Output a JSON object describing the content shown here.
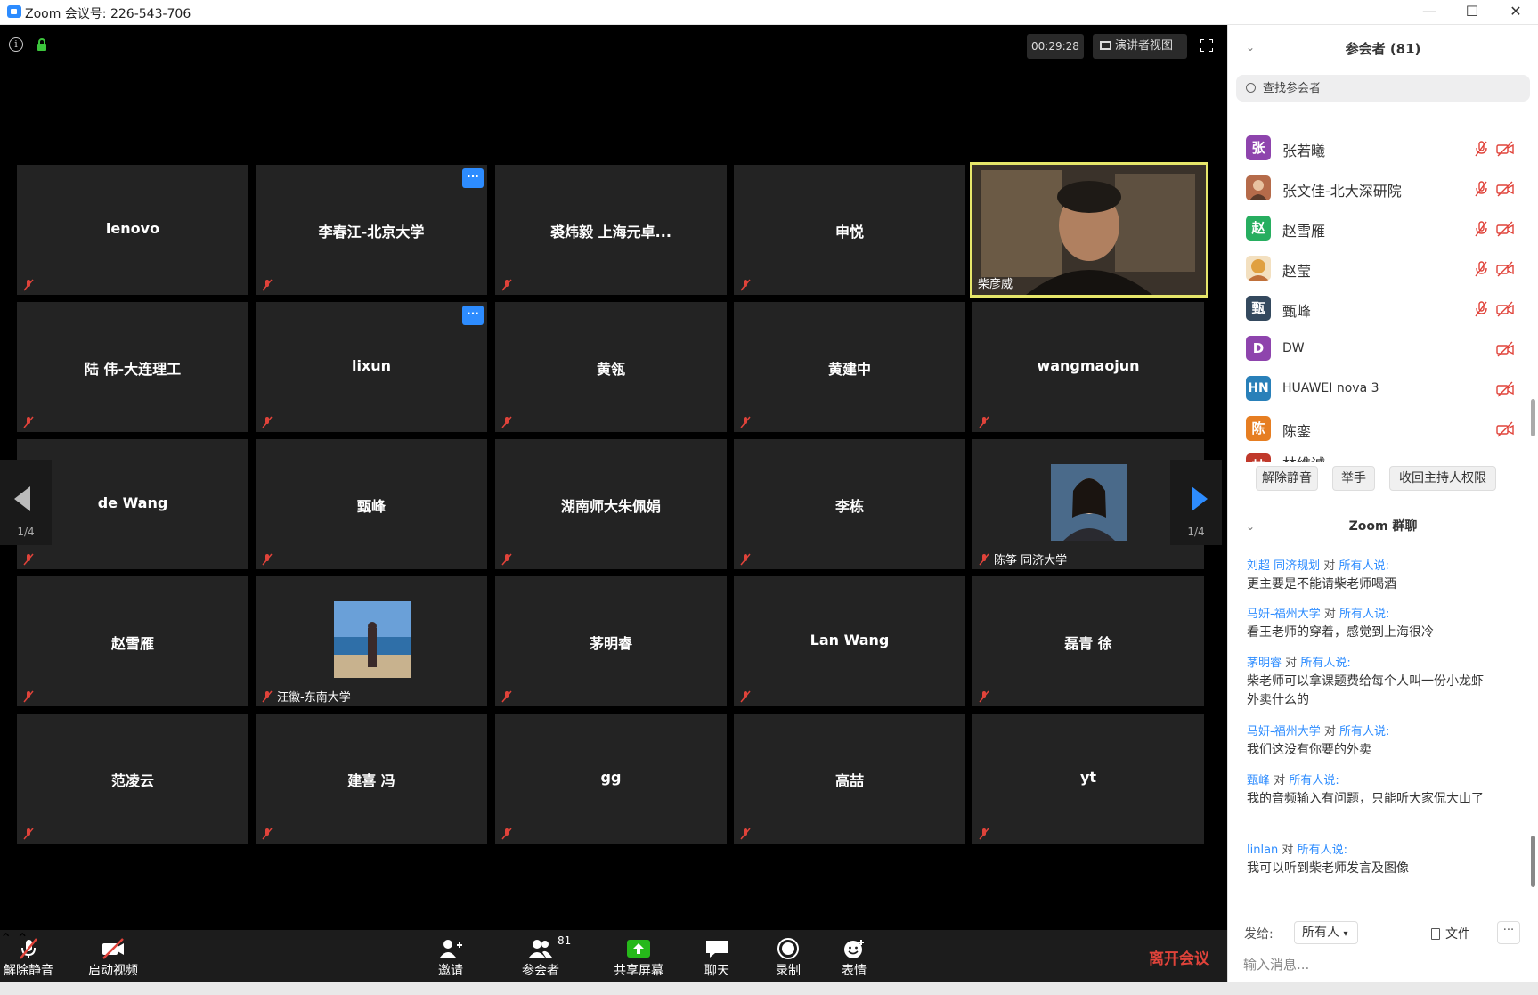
{
  "window": {
    "title": "Zoom 会议号: 226-543-706"
  },
  "meeting": {
    "timer": "00:29:28",
    "speaker_view_label": "演讲者视图"
  },
  "pager": {
    "left_page": "1/4",
    "right_page": "1/4"
  },
  "tiles": [
    {
      "name": "lenovo"
    },
    {
      "name": "李春江-北京大学"
    },
    {
      "name": "裘炜毅 上海元卓..."
    },
    {
      "name": "申悦"
    },
    {
      "name": "柴彦威"
    },
    {
      "name": "陆 伟-大连理工"
    },
    {
      "name": "lixun"
    },
    {
      "name": "黄瓴"
    },
    {
      "name": "黄建中"
    },
    {
      "name": "wangmaojun"
    },
    {
      "name": "de Wang"
    },
    {
      "name": "甄峰"
    },
    {
      "name": "湖南师大朱佩娟"
    },
    {
      "name": "李栋"
    },
    {
      "name": "陈筝 同济大学"
    },
    {
      "name": "赵雪雁"
    },
    {
      "name": "汪徽-东南大学"
    },
    {
      "name": "茅明睿"
    },
    {
      "name": "Lan Wang"
    },
    {
      "name": "磊青 徐"
    },
    {
      "name": "范凌云"
    },
    {
      "name": "建喜 冯"
    },
    {
      "name": "gg"
    },
    {
      "name": "高喆"
    },
    {
      "name": "yt"
    }
  ],
  "toolbar": {
    "unmute": "解除静音",
    "start_video": "启动视频",
    "invite": "邀请",
    "participants": "参会者",
    "participants_count": "81",
    "share": "共享屏幕",
    "chat": "聊天",
    "record": "录制",
    "reactions": "表情",
    "leave": "离开会议"
  },
  "participants_panel": {
    "title": "参会者 (81)",
    "search_placeholder": "查找参会者",
    "list": [
      {
        "initial": "张",
        "name": "张若曦",
        "color": "#8e44ad"
      },
      {
        "initial": "",
        "name": "张文佳-北大深研院",
        "color": "#b56b4a"
      },
      {
        "initial": "赵",
        "name": "赵雪雁",
        "color": "#27ae60"
      },
      {
        "initial": "",
        "name": "赵莹",
        "color": "#e0a040"
      },
      {
        "initial": "甄",
        "name": "甄峰",
        "color": "#34495e"
      },
      {
        "initial": "D",
        "name": "DW",
        "color": "#8e44ad"
      },
      {
        "initial": "HN",
        "name": "HUAWEI nova 3",
        "color": "#2980b9"
      },
      {
        "initial": "陈",
        "name": "陈銮",
        "color": "#e67e22"
      },
      {
        "initial": "林",
        "name": "林维诚",
        "color": "#c0392b"
      }
    ],
    "buttons": {
      "unmute_all": "解除静音",
      "raise_hand": "举手",
      "reclaim_host": "收回主持人权限"
    }
  },
  "chat": {
    "title": "Zoom 群聊",
    "to_word": "对",
    "everyone": "所有人说:",
    "messages": [
      {
        "from": "刘超 同济规划",
        "text": "更主要是不能请柴老师喝酒"
      },
      {
        "from": "马妍-福州大学",
        "text": "看王老师的穿着，感觉到上海很冷"
      },
      {
        "from": "茅明睿",
        "text": "柴老师可以拿课题费给每个人叫一份小龙虾外卖什么的"
      },
      {
        "from": "马妍-福州大学",
        "text": "我们这没有你要的外卖"
      },
      {
        "from": "甄峰",
        "text": "我的音频输入有问题，只能听大家侃大山了"
      },
      {
        "from": "linlan",
        "text": "我可以听到柴老师发言及图像"
      }
    ],
    "send_to_label": "发给:",
    "recipient": "所有人",
    "file_label": "文件",
    "more": "···",
    "input_placeholder": "输入消息..."
  }
}
